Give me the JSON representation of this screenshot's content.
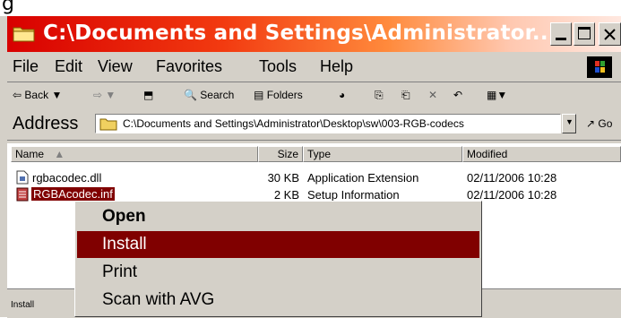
{
  "window": {
    "title": "C:\\Documents and Settings\\Administrator...",
    "title_gradient": [
      "#d80000",
      "#ffe8e0"
    ]
  },
  "menubar": {
    "items": [
      "File",
      "Edit",
      "View",
      "Favorites",
      "Tools",
      "Help"
    ]
  },
  "toolbar": {
    "back_label": "Back",
    "search_label": "Search",
    "folders_label": "Folders"
  },
  "address": {
    "label": "Address",
    "value": "C:\\Documents and Settings\\Administrator\\Desktop\\sw\\003-RGB-codecs",
    "go_label": "Go"
  },
  "list": {
    "columns": [
      "Name",
      "Size",
      "Type",
      "Modified"
    ],
    "rows": [
      {
        "name": "rgbacodec.dll",
        "size": "30 KB",
        "type": "Application Extension",
        "modified": "02/11/2006 10:28"
      },
      {
        "name": "RGBAcodec.inf",
        "size": "2 KB",
        "type": "Setup Information",
        "modified": "02/11/2006 10:28"
      }
    ]
  },
  "context_menu": {
    "items": [
      "Open",
      "Install",
      "Print",
      "Scan with AVG"
    ],
    "highlight_color": "#800000"
  },
  "statusbar": {
    "text": "Install"
  }
}
